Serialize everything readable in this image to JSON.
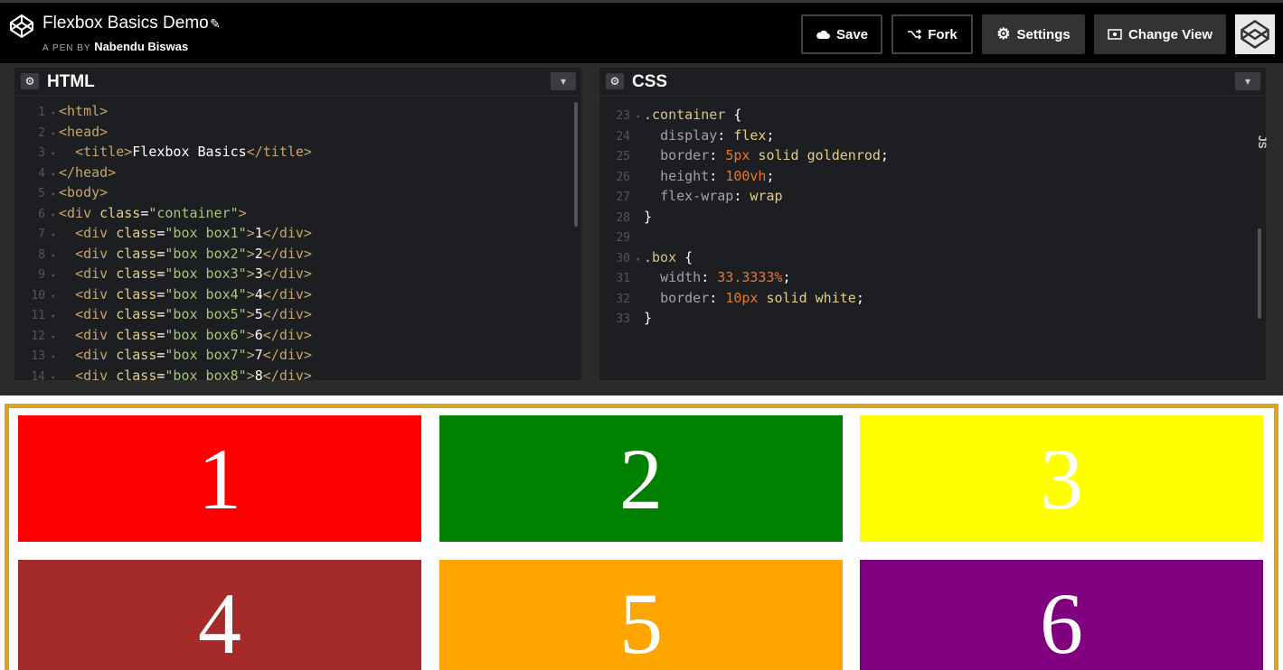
{
  "header": {
    "title": "Flexbox Basics Demo",
    "byline_prefix": "A PEN BY",
    "author": "Nabendu Biswas",
    "buttons": {
      "save": "Save",
      "fork": "Fork",
      "settings": "Settings",
      "change_view": "Change View"
    }
  },
  "html_panel": {
    "title": "HTML",
    "lines": [
      {
        "n": "1",
        "code": [
          [
            "tag",
            "<html>"
          ]
        ]
      },
      {
        "n": "2",
        "code": [
          [
            "tag",
            "<head>"
          ]
        ]
      },
      {
        "n": "3",
        "code": [
          [
            "txt",
            "  "
          ],
          [
            "tag",
            "<title>"
          ],
          [
            "txt",
            "Flexbox Basics"
          ],
          [
            "tag",
            "</title>"
          ]
        ]
      },
      {
        "n": "4",
        "code": [
          [
            "tag",
            "</head>"
          ]
        ]
      },
      {
        "n": "5",
        "code": [
          [
            "tag",
            "<body>"
          ]
        ]
      },
      {
        "n": "6",
        "code": [
          [
            "tag",
            "<div "
          ],
          [
            "attr",
            "class"
          ],
          [
            "txt",
            "="
          ],
          [
            "str",
            "\"container\""
          ],
          [
            "tag",
            ">"
          ]
        ]
      },
      {
        "n": "7",
        "code": [
          [
            "txt",
            "  "
          ],
          [
            "tag",
            "<div "
          ],
          [
            "attr",
            "class"
          ],
          [
            "txt",
            "="
          ],
          [
            "str",
            "\"box box1\""
          ],
          [
            "tag",
            ">"
          ],
          [
            "txt",
            "1"
          ],
          [
            "tag",
            "</div>"
          ]
        ]
      },
      {
        "n": "8",
        "code": [
          [
            "txt",
            "  "
          ],
          [
            "tag",
            "<div "
          ],
          [
            "attr",
            "class"
          ],
          [
            "txt",
            "="
          ],
          [
            "str",
            "\"box box2\""
          ],
          [
            "tag",
            ">"
          ],
          [
            "txt",
            "2"
          ],
          [
            "tag",
            "</div>"
          ]
        ]
      },
      {
        "n": "9",
        "code": [
          [
            "txt",
            "  "
          ],
          [
            "tag",
            "<div "
          ],
          [
            "attr",
            "class"
          ],
          [
            "txt",
            "="
          ],
          [
            "str",
            "\"box box3\""
          ],
          [
            "tag",
            ">"
          ],
          [
            "txt",
            "3"
          ],
          [
            "tag",
            "</div>"
          ]
        ]
      },
      {
        "n": "10",
        "code": [
          [
            "txt",
            "  "
          ],
          [
            "tag",
            "<div "
          ],
          [
            "attr",
            "class"
          ],
          [
            "txt",
            "="
          ],
          [
            "str",
            "\"box box4\""
          ],
          [
            "tag",
            ">"
          ],
          [
            "txt",
            "4"
          ],
          [
            "tag",
            "</div>"
          ]
        ]
      },
      {
        "n": "11",
        "code": [
          [
            "txt",
            "  "
          ],
          [
            "tag",
            "<div "
          ],
          [
            "attr",
            "class"
          ],
          [
            "txt",
            "="
          ],
          [
            "str",
            "\"box box5\""
          ],
          [
            "tag",
            ">"
          ],
          [
            "txt",
            "5"
          ],
          [
            "tag",
            "</div>"
          ]
        ]
      },
      {
        "n": "12",
        "code": [
          [
            "txt",
            "  "
          ],
          [
            "tag",
            "<div "
          ],
          [
            "attr",
            "class"
          ],
          [
            "txt",
            "="
          ],
          [
            "str",
            "\"box box6\""
          ],
          [
            "tag",
            ">"
          ],
          [
            "txt",
            "6"
          ],
          [
            "tag",
            "</div>"
          ]
        ]
      },
      {
        "n": "13",
        "code": [
          [
            "txt",
            "  "
          ],
          [
            "tag",
            "<div "
          ],
          [
            "attr",
            "class"
          ],
          [
            "txt",
            "="
          ],
          [
            "str",
            "\"box box7\""
          ],
          [
            "tag",
            ">"
          ],
          [
            "txt",
            "7"
          ],
          [
            "tag",
            "</div>"
          ]
        ]
      },
      {
        "n": "14",
        "code": [
          [
            "txt",
            "  "
          ],
          [
            "tag",
            "<div "
          ],
          [
            "attr",
            "class"
          ],
          [
            "txt",
            "="
          ],
          [
            "str",
            "\"box box8\""
          ],
          [
            "tag",
            ">"
          ],
          [
            "txt",
            "8"
          ],
          [
            "tag",
            "</div>"
          ]
        ]
      }
    ]
  },
  "css_panel": {
    "title": "CSS",
    "lines": [
      {
        "n": "23",
        "code": [
          [
            "sel",
            ".container "
          ],
          [
            "brace",
            "{"
          ]
        ]
      },
      {
        "n": "24",
        "code": [
          [
            "txt",
            "  "
          ],
          [
            "prop",
            "display"
          ],
          [
            "txt",
            ": "
          ],
          [
            "val",
            "flex"
          ],
          [
            "txt",
            ";"
          ]
        ]
      },
      {
        "n": "25",
        "code": [
          [
            "txt",
            "  "
          ],
          [
            "prop",
            "border"
          ],
          [
            "txt",
            ": "
          ],
          [
            "num",
            "5px"
          ],
          [
            "val",
            " solid goldenrod"
          ],
          [
            "txt",
            ";"
          ]
        ]
      },
      {
        "n": "26",
        "code": [
          [
            "txt",
            "  "
          ],
          [
            "prop",
            "height"
          ],
          [
            "txt",
            ": "
          ],
          [
            "num",
            "100vh"
          ],
          [
            "txt",
            ";"
          ]
        ]
      },
      {
        "n": "27",
        "code": [
          [
            "txt",
            "  "
          ],
          [
            "prop",
            "flex-wrap"
          ],
          [
            "txt",
            ": "
          ],
          [
            "val",
            "wrap"
          ]
        ]
      },
      {
        "n": "28",
        "code": [
          [
            "brace",
            "}"
          ]
        ]
      },
      {
        "n": "29",
        "code": []
      },
      {
        "n": "30",
        "code": [
          [
            "sel",
            ".box "
          ],
          [
            "brace",
            "{"
          ]
        ]
      },
      {
        "n": "31",
        "code": [
          [
            "txt",
            "  "
          ],
          [
            "prop",
            "width"
          ],
          [
            "txt",
            ": "
          ],
          [
            "num",
            "33.3333%"
          ],
          [
            "txt",
            ";"
          ]
        ]
      },
      {
        "n": "32",
        "code": [
          [
            "txt",
            "  "
          ],
          [
            "prop",
            "border"
          ],
          [
            "txt",
            ": "
          ],
          [
            "num",
            "10px"
          ],
          [
            "val",
            " solid white"
          ],
          [
            "txt",
            ";"
          ]
        ]
      },
      {
        "n": "33",
        "code": [
          [
            "brace",
            "}"
          ]
        ]
      }
    ]
  },
  "side_tab": "JS",
  "preview": {
    "border_color": "#daa520",
    "boxes": [
      {
        "label": "1",
        "color": "#ff0000"
      },
      {
        "label": "2",
        "color": "#008000"
      },
      {
        "label": "3",
        "color": "#ffff00"
      },
      {
        "label": "4",
        "color": "#a52a2a"
      },
      {
        "label": "5",
        "color": "#ffa500"
      },
      {
        "label": "6",
        "color": "#800080"
      }
    ]
  }
}
